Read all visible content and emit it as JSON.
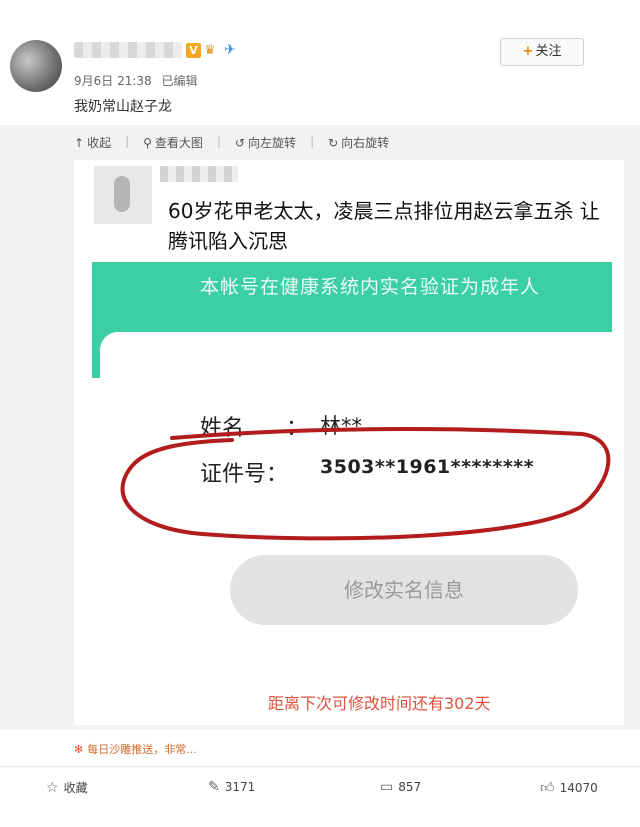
{
  "post": {
    "date": "9月6日 21:38",
    "edited": "已编辑",
    "vip_badge": "V",
    "follow_plus": "+",
    "follow_label": "关注",
    "text": "我奶常山赵子龙"
  },
  "toolbar": {
    "collapse": "收起",
    "view_large": "查看大图",
    "rotate_left": "向左旋转",
    "rotate_right": "向右旋转"
  },
  "image": {
    "caption": "60岁花甲老太太，凌晨三点排位用赵云拿五杀 让 腾讯陷入沉思",
    "banner_text": "本帐号在健康系统内实名验证为成年人",
    "name_label": "姓名",
    "colon": "：",
    "name_value": "林**",
    "id_label": "证件号：",
    "id_value": "3503**1961********",
    "modify_button": "修改实名信息",
    "countdown_text": "距离下次可修改时间还有302天"
  },
  "notice": {
    "text": "每日沙雕推送，非常..."
  },
  "actions": {
    "favorite_label": "收藏",
    "repost_count": "3171",
    "comment_count": "857",
    "like_count": "14070"
  },
  "colors": {
    "accent_orange": "#f08300",
    "banner_green": "#3dcfa4",
    "circle_red": "#b21c1c",
    "countdown_red": "#e0533c"
  }
}
